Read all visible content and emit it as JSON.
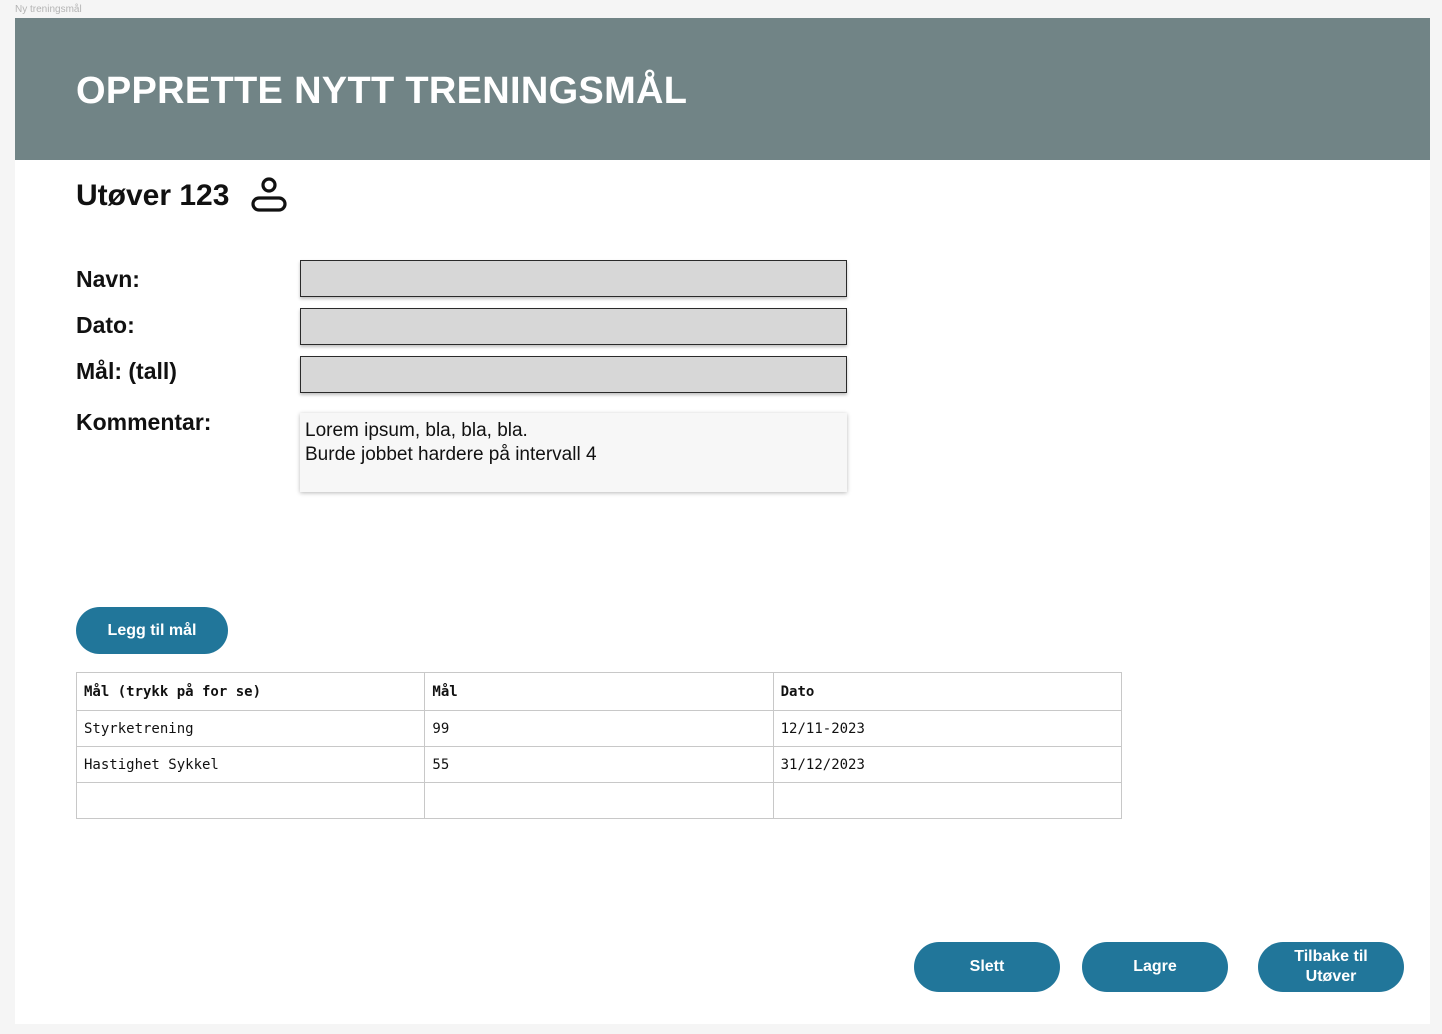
{
  "window": {
    "frame_label": "Ny treningsmål"
  },
  "header": {
    "title": "OPPRETTE NYTT TRENINGSMÅL"
  },
  "athlete": {
    "name": "Utøver 123",
    "icon": "user-icon"
  },
  "form": {
    "name_label": "Navn:",
    "name_value": "",
    "date_label": "Dato:",
    "date_value": "",
    "goal_label": "Mål: (tall)",
    "goal_value": "",
    "comment_label": "Kommentar:",
    "comment_lines": [
      "Lorem ipsum, bla, bla, bla.",
      "Burde jobbet hardere på intervall 4"
    ]
  },
  "add_button": {
    "label": "Legg til mål"
  },
  "table": {
    "headers": [
      "Mål (trykk på for se)",
      "Mål",
      "Dato"
    ],
    "rows": [
      [
        "Styrketrening",
        "99",
        "12/11-2023"
      ],
      [
        "Hastighet Sykkel",
        "55",
        "31/12/2023"
      ],
      [
        "",
        "",
        ""
      ]
    ]
  },
  "actions": {
    "delete_label": "Slett",
    "save_label": "Lagre",
    "back_label": "Tilbake til Utøver"
  },
  "colors": {
    "header_bg": "#718486",
    "button_bg": "#21769a",
    "field_bg": "#d7d7d7"
  }
}
